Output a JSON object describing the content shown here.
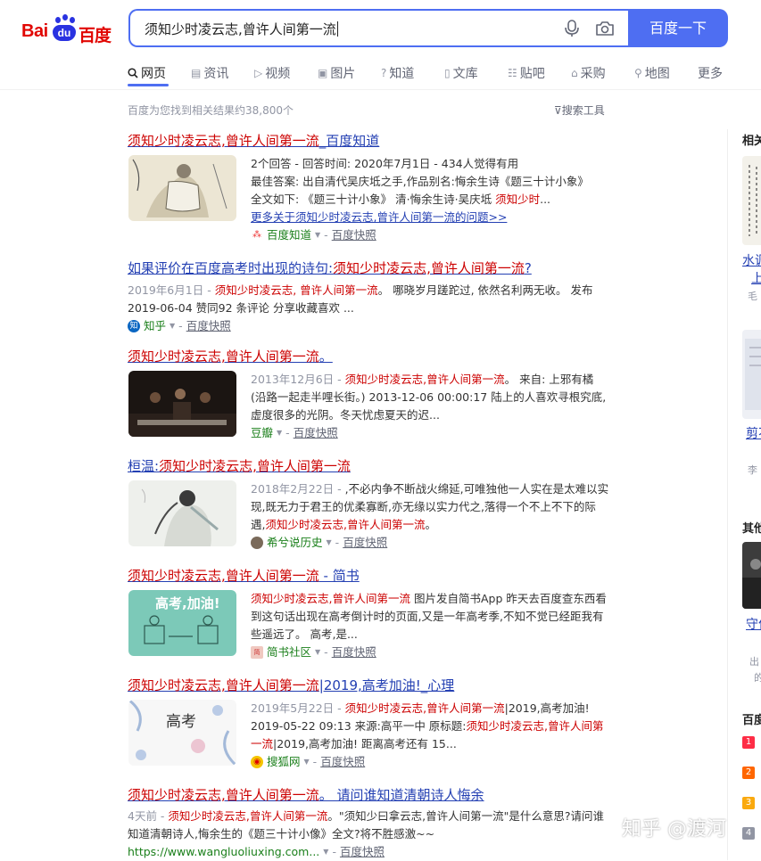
{
  "logo": {
    "bai": "Bai",
    "du": "du",
    "baidu": "百度"
  },
  "search": {
    "query": "须知少时凌云志,曾许人间第一流",
    "button": "百度一下"
  },
  "tabs": [
    {
      "label": "网页",
      "icon": "search-icon"
    },
    {
      "label": "资讯",
      "icon": "news-icon"
    },
    {
      "label": "视频",
      "icon": "video-icon"
    },
    {
      "label": "图片",
      "icon": "image-icon"
    },
    {
      "label": "知道",
      "icon": "question-icon"
    },
    {
      "label": "文库",
      "icon": "doc-icon"
    },
    {
      "label": "贴吧",
      "icon": "tieba-icon"
    },
    {
      "label": "采购",
      "icon": "bag-icon"
    },
    {
      "label": "地图",
      "icon": "map-icon"
    },
    {
      "label": "更多",
      "icon": ""
    }
  ],
  "result_count": "百度为您找到相关结果约38,800个",
  "search_tools": "搜索工具",
  "results": [
    {
      "title_em": "须知少时凌云志,曾许人间第一流",
      "title_rest": "_百度知道",
      "lines": [
        "2个回答 - 回答时间: 2020年7月1日 - 434人觉得有用",
        "最佳答案: 出自清代吴庆坻之手,作品别名:悔余生诗《题三十计小象》",
        "全文如下: 《题三十计小象》 清·悔余生诗·吴庆坻 "
      ],
      "line3_em": "须知少时",
      "line3_tail": "...",
      "more": "更多关于须知少时凌云志,曾许人间第一流的问题>>",
      "source": "百度知道",
      "snapshot": "百度快照"
    },
    {
      "title_pre": "如果评价在百度高考时出现的诗句:",
      "title_em": "须知少时凌云志,曾许人间第一流",
      "title_rest": "?",
      "date": "2019年6月1日 - ",
      "em": "须知少时凌云志, 曾许人间第一流",
      "text": "。 哪晓岁月蹉跎过, 依然名利两无收。 发布 2019-06-04 赞同92 条评论 分享收藏喜欢 ...",
      "source": "知乎",
      "snapshot": "百度快照"
    },
    {
      "title_em": "须知少时凌云志,曾许人间第一流",
      "title_rest": "。",
      "date": "2013年12月6日 - ",
      "em": "须知少时凌云志,曾许人间第一流",
      "text": "。 来自: 上邪有橘 (沿路一起走半哩长街。) 2013-12-06 00:00:17 陆上的人喜欢寻根究底,虚度很多的光阴。冬天忧虑夏天的迟...",
      "source": "豆瓣",
      "snapshot": "百度快照"
    },
    {
      "title_pre": "桓温:",
      "title_em": "须知少时凌云志,曾许人间第一流",
      "title_rest": "",
      "date": "2018年2月22日 - ",
      "text": ",不必内争不断战火绵延,可唯独他一人实在是太难以实现,既无力于君王的优柔寡断,亦无缘以实力代之,落得一个不上不下的际遇,",
      "em": "须知少时凌云志,曾许人间第一流",
      "text2": "。",
      "source": "希兮说历史",
      "snapshot": "百度快照"
    },
    {
      "title_em": "须知少时凌云志,曾许人间第一流",
      "title_rest": " - 简书",
      "em": "须知少时凌云志,曾许人间第一流",
      "text": " 图片发自简书App 昨天去百度查东西看到这句话出现在高考倒计时的页面,又是一年高考季,不知不觉已经距我有些遥远了。 高考,是...",
      "thumb_text": "高考,加油!",
      "source": "简书社区",
      "snapshot": "百度快照"
    },
    {
      "title_em": "须知少时凌云志,曾许人间第一流",
      "title_rest": "|2019,高考加油!_心理",
      "date": "2019年5月22日 - ",
      "em": "须知少时凌云志,曾许人间第一流",
      "text": "|2019,高考加油! 2019-05-22 09:13 来源:高平一中 原标题:",
      "em2": "须知少时凌云志,曾许人间第一流",
      "text2": "|2019,高考加油! 距离高考还有 15...",
      "thumb_text": "高考",
      "source": "搜狐网",
      "snapshot": "百度快照"
    },
    {
      "title_em": "须知少时凌云志,曾许人间第一流",
      "title_rest": "。 请问谁知道清朝诗人悔余",
      "date": "4天前 - ",
      "em": "须知少时凌云志,曾许人间第一流",
      "text": "。\"须知少曰拿云志,曾许人间第一流\"是什么意思?请问谁知道清朝诗人,悔余生的《题三十计小像》全文?将不胜感激~~",
      "source": "https://www.wangluoliuxing.com...",
      "snapshot": "百度快照"
    }
  ],
  "right": {
    "related_head": "相关",
    "link1a": "水调",
    "link1b": "上",
    "small1": "毛",
    "link2": "剪不",
    "small2": "李",
    "other_head": "其他",
    "link3": "守住",
    "small3a": "出",
    "small3b": "的",
    "hot_head": "百度",
    "ranks": [
      "1",
      "2",
      "3",
      "4"
    ]
  },
  "watermark": "知乎 @渡河",
  "colors": {
    "accent": "#4e6ef2",
    "link": "#2440b3",
    "em": "#cc0000",
    "source": "#1a7f1a",
    "logo_red": "#e10602"
  }
}
